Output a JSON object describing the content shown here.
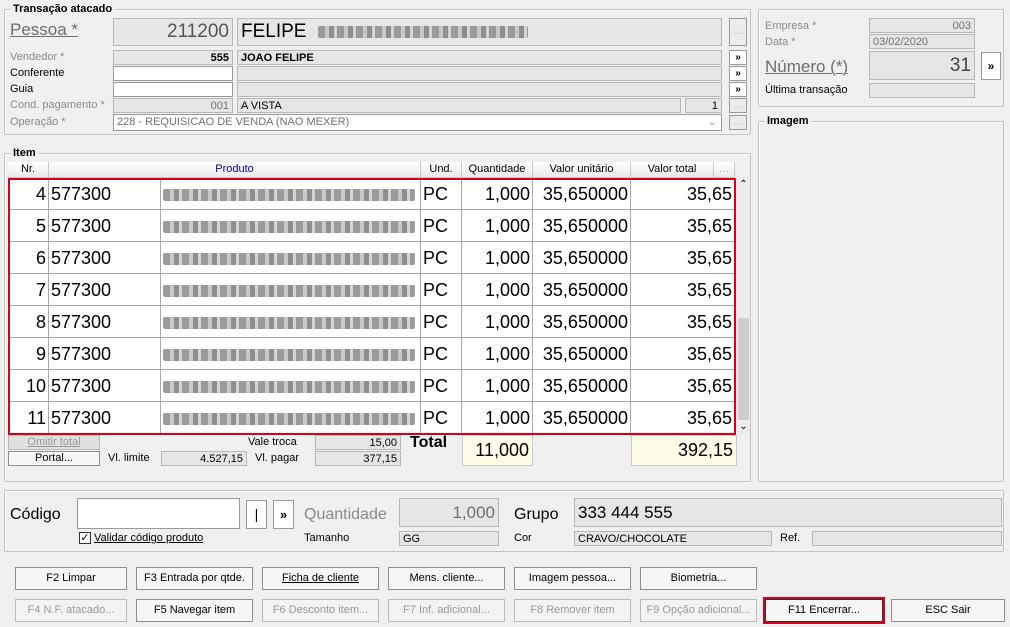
{
  "transacao": {
    "title": "Transação atacado",
    "pessoa_label": "Pessoa *",
    "pessoa_code": "211200",
    "pessoa_name": "FELIPE",
    "vendedor_label": "Vendedor *",
    "vendedor_code": "555",
    "vendedor_name": "JOAO FELIPE",
    "conferente_label": "Conferente",
    "guia_label": "Guia",
    "cond_label": "Cond. pagamento *",
    "cond_code": "001",
    "cond_name": "A VISTA",
    "cond_parcelas": "1",
    "operacao_label": "Operação *",
    "operacao_value": "228 - REQUISICAO DE VENDA (NAO MEXER)",
    "more_btn": "»",
    "ellipsis_btn": "…"
  },
  "empresa": {
    "empresa_label": "Empresa *",
    "empresa_value": "003",
    "data_label": "Data *",
    "data_value": "03/02/2020",
    "numero_label": "Número (*)",
    "numero_value": "31",
    "ultima_label": "Última transação"
  },
  "imagem": {
    "title": "Imagem"
  },
  "item": {
    "title": "Item",
    "columns": [
      "Nr.",
      "Produto",
      "Und.",
      "Quantidade",
      "Valor unitário",
      "Valor total"
    ],
    "rows": [
      {
        "nr": "4",
        "code": "577300",
        "und": "PC",
        "qtd": "1,000",
        "unit": "35,650000",
        "total": "35,65"
      },
      {
        "nr": "5",
        "code": "577300",
        "und": "PC",
        "qtd": "1,000",
        "unit": "35,650000",
        "total": "35,65"
      },
      {
        "nr": "6",
        "code": "577300",
        "und": "PC",
        "qtd": "1,000",
        "unit": "35,650000",
        "total": "35,65"
      },
      {
        "nr": "7",
        "code": "577300",
        "und": "PC",
        "qtd": "1,000",
        "unit": "35,650000",
        "total": "35,65"
      },
      {
        "nr": "8",
        "code": "577300",
        "und": "PC",
        "qtd": "1,000",
        "unit": "35,650000",
        "total": "35,65"
      },
      {
        "nr": "9",
        "code": "577300",
        "und": "PC",
        "qtd": "1,000",
        "unit": "35,650000",
        "total": "35,65"
      },
      {
        "nr": "10",
        "code": "577300",
        "und": "PC",
        "qtd": "1,000",
        "unit": "35,650000",
        "total": "35,65"
      },
      {
        "nr": "11",
        "code": "577300",
        "und": "PC",
        "qtd": "1,000",
        "unit": "35,650000",
        "total": "35,65"
      }
    ]
  },
  "totals": {
    "omitir_label": "Omitir total",
    "portal_label": "Portal...",
    "vl_limite_label": "Vl. limite",
    "vl_limite_value": "4.527,15",
    "vale_troca_label": "Vale troca",
    "vale_troca_value": "15,00",
    "vl_pagar_label": "Vl. pagar",
    "vl_pagar_value": "377,15",
    "total_label": "Total",
    "total_qtd": "11,000",
    "total_valor": "392,15"
  },
  "entry": {
    "codigo_label": "Código",
    "codigo_value": "",
    "pipe_btn": "|",
    "more_btn": "»",
    "validar_label": "Validar código produto",
    "quantidade_label": "Quantidade",
    "quantidade_value": "1,000",
    "tamanho_label": "Tamanho",
    "tamanho_value": "GG",
    "grupo_label": "Grupo",
    "grupo_value": "333 444 555",
    "cor_label": "Cor",
    "cor_value": "CRAVO/CHOCOLATE",
    "ref_label": "Ref."
  },
  "buttons": {
    "f2": "F2 Limpar",
    "f3": "F3 Entrada por qtde.",
    "ficha": "Ficha de cliente",
    "mens": "Mens. cliente...",
    "imagem": "Imagem pessoa...",
    "biometria": "Biometria...",
    "f4": "F4 N.F. atacado...",
    "f5": "F5 Navegar item",
    "f6": "F6 Desconto item...",
    "f7": "F7 Inf. adicional...",
    "f8": "F8 Remover item",
    "f9": "F9 Opção adicional...",
    "f11": "F11 Encerrar...",
    "esc": "ESC Sair"
  },
  "colors": {
    "highlight": "#d9001b",
    "total_bg": "#fffde8",
    "header_text": "#0000a0"
  }
}
